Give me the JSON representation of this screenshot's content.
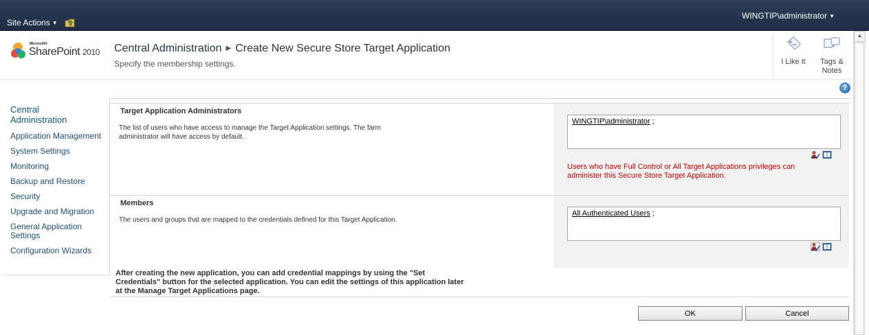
{
  "ribbon": {
    "site_actions": "Site Actions",
    "user": "WINGTIP\\administrator"
  },
  "logo": {
    "microsoft": "Microsoft®",
    "product": "SharePoint",
    "year": "2010"
  },
  "header": {
    "breadcrumb_root": "Central Administration",
    "breadcrumb_current": "Create New Secure Store Target Application",
    "subtitle": "Specify the membership settings."
  },
  "social": {
    "like": "I Like It",
    "tags_line1": "Tags &",
    "tags_line2": "Notes"
  },
  "help": "?",
  "nav": {
    "head_line1": "Central",
    "head_line2": "Administration",
    "items": [
      "Application Management",
      "System Settings",
      "Monitoring",
      "Backup and Restore",
      "Security",
      "Upgrade and Migration",
      "General Application",
      "Settings",
      "Configuration Wizards"
    ]
  },
  "admins": {
    "title": "Target Application Administrators",
    "desc_line1": "The list of users who have access to manage the Target Application settings. The farm",
    "desc_line2": "administrator will have access by default.",
    "value": "WINGTIP\\administrator",
    "sep": " ;",
    "warn_line1": "Users who have Full Control or All Target Applications privileges can",
    "warn_line2": "administer this Secure Store Target Application."
  },
  "members": {
    "title": "Members",
    "desc": "The users and groups that are mapped to the credentials defined for this Target Application.",
    "value": "All Authenticated Users",
    "sep": " ;"
  },
  "footnote": {
    "line1": "After creating the new application, you can add credential mappings by using the \"Set",
    "line2": "Credentials\" button for the selected application. You can edit the settings of this application later",
    "line3": "at the Manage Target Applications page."
  },
  "buttons": {
    "ok": "OK",
    "cancel": "Cancel"
  },
  "colors": {
    "ribbon": "#1f2d44",
    "warning": "#cc0000",
    "link": "#1e4e79"
  },
  "icons": [
    "navigate-up-icon",
    "i-like-it-icon",
    "tags-notes-icon",
    "help-icon",
    "check-names-icon",
    "browse-address-book-icon"
  ]
}
